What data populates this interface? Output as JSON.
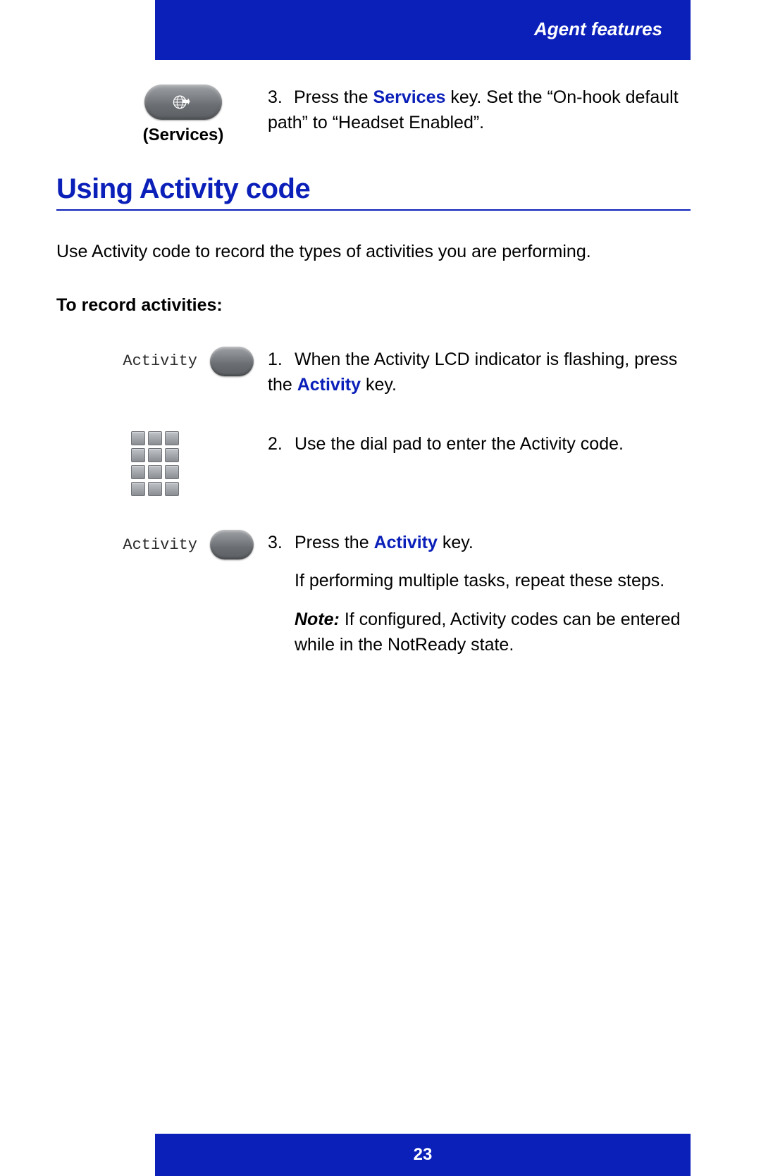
{
  "header": {
    "title": "Agent features"
  },
  "footer": {
    "page_number": "23"
  },
  "top_step": {
    "button_caption": "(Services)",
    "number": "3.",
    "text_before": "Press the ",
    "services_word": "Services",
    "text_after": " key. Set the “On-hook default path” to “Headset Enabled”."
  },
  "section": {
    "heading": "Using Activity code",
    "intro": "Use Activity code to record the types of activities you are performing.",
    "sub_heading": "To record activities:"
  },
  "steps": [
    {
      "left_label": "Activity",
      "number": "1.",
      "text_before": "When the Activity LCD indicator is flashing, press the ",
      "activity_word": "Activity",
      "text_after": " key."
    },
    {
      "number": "2.",
      "text": "Use the dial pad to enter the Activity code."
    },
    {
      "left_label": "Activity",
      "number": "3.",
      "text_before": "Press the ",
      "activity_word": "Activity",
      "text_after": " key.",
      "extra1": "If performing multiple tasks, repeat these steps.",
      "note_label": "Note:",
      "note_text": " If configured, Activity codes can be entered while in the NotReady state."
    }
  ]
}
